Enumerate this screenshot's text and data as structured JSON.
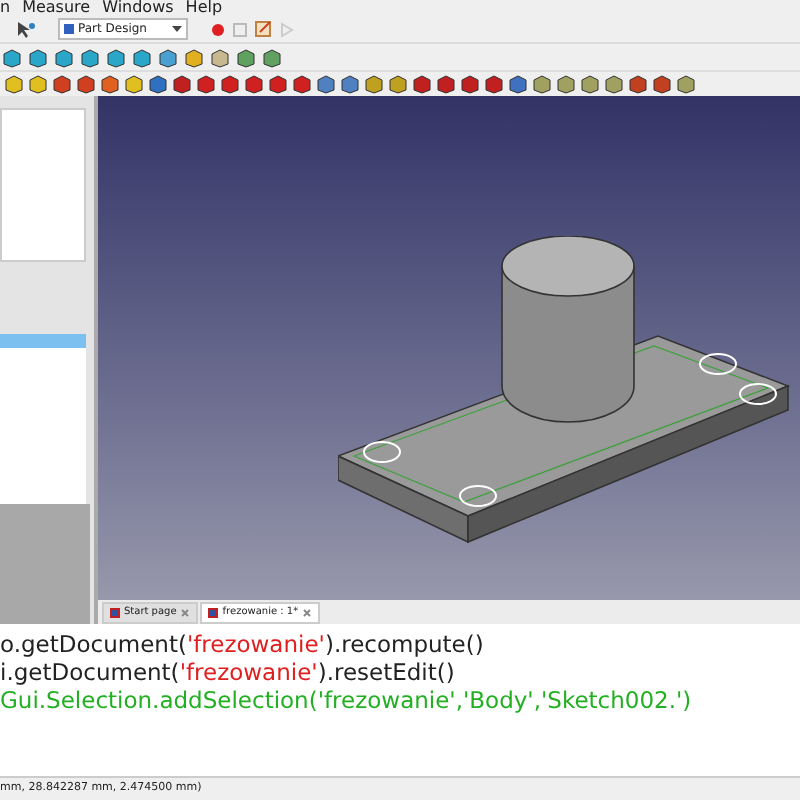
{
  "menu": [
    "n",
    "Measure",
    "Windows",
    "Help"
  ],
  "workbench": {
    "value": "Part Design"
  },
  "doc_tabs": [
    {
      "label": "Start page",
      "selected": false
    },
    {
      "label": "frezowanie : 1*",
      "selected": true
    }
  ],
  "console": {
    "lines": [
      [
        {
          "kind": "code",
          "text": "o.getDocument("
        },
        {
          "kind": "string",
          "text": "'frezowanie'"
        },
        {
          "kind": "code",
          "text": ").recompute()"
        }
      ],
      [
        {
          "kind": "code",
          "text": "i.getDocument("
        },
        {
          "kind": "string",
          "text": "'frezowanie'"
        },
        {
          "kind": "code",
          "text": ").resetEdit()"
        }
      ],
      [
        {
          "kind": "echo",
          "text": "Gui.Selection.addSelection('frezowanie','Body','Sketch002.')"
        }
      ]
    ]
  },
  "status_bar": "mm, 28.842287 mm, 2.474500 mm)"
}
